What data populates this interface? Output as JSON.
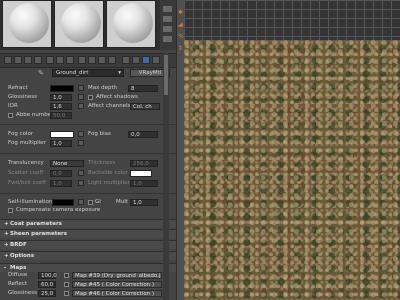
{
  "material": {
    "name": "Ground_dirt",
    "type": "VRayMtl"
  },
  "refract": {
    "label": "Refract",
    "glossiness": {
      "label": "Glossiness",
      "value": "1,0"
    },
    "ior": {
      "label": "IOR",
      "value": "1,6"
    },
    "abbe": {
      "label": "Abbe number",
      "value": "50,0"
    },
    "max_depth": {
      "label": "Max depth",
      "value": "8"
    },
    "affect_shadows": "Affect shadows",
    "affect_channels": {
      "label": "Affect channels",
      "value": "Col. ch"
    }
  },
  "fog": {
    "color_label": "Fog color",
    "bias": {
      "label": "Fog bias",
      "value": "0,0"
    },
    "multiplier": {
      "label": "Fog multiplier",
      "value": "1,0"
    }
  },
  "translucency": {
    "label": "Translucency",
    "value": "None",
    "thickness": {
      "label": "Thickness",
      "value": "256,0"
    },
    "scatter": {
      "label": "Scatter coeff",
      "value": "0,0"
    },
    "fwdbck": {
      "label": "Fwd/bck coeff",
      "value": "1,0"
    },
    "backside_color": "Backside color",
    "light_multiplier": {
      "label": "Light multiplier",
      "value": "1,0"
    }
  },
  "self_illum": {
    "label": "Self-illumination",
    "gi": "GI",
    "mult": {
      "label": "Mult",
      "value": "1,0"
    },
    "compensate": "Compensate camera exposure"
  },
  "rollouts": [
    {
      "sign": "+",
      "label": "Coat parameters"
    },
    {
      "sign": "+",
      "label": "Sheen parameters"
    },
    {
      "sign": "+",
      "label": "BRDF"
    },
    {
      "sign": "+",
      "label": "Options"
    },
    {
      "sign": "-",
      "label": "Maps"
    }
  ],
  "maps": [
    {
      "label": "Diffuse",
      "amount": "100,0",
      "map": "Map #39 (Dry_ground_albedo.jpg)"
    },
    {
      "label": "Reflect",
      "amount": "60,0",
      "map": "Map #45  ( Color Correction )"
    },
    {
      "label": "Glossiness",
      "amount": "25,0",
      "map": "Map #46  ( Color Correction )"
    }
  ],
  "colors": {
    "panel_bg": "#444444",
    "refract_swatch": "#000000",
    "fog_swatch": "#ffffff",
    "backside_swatch": "#ffffff",
    "self_illum_swatch": "#000000",
    "toolbar_active": "#3a6ea5",
    "snap_icon": "#d08030"
  },
  "icons": {
    "dropper": "eyedropper-icon",
    "map_slot": "map-slot-button-icon"
  }
}
